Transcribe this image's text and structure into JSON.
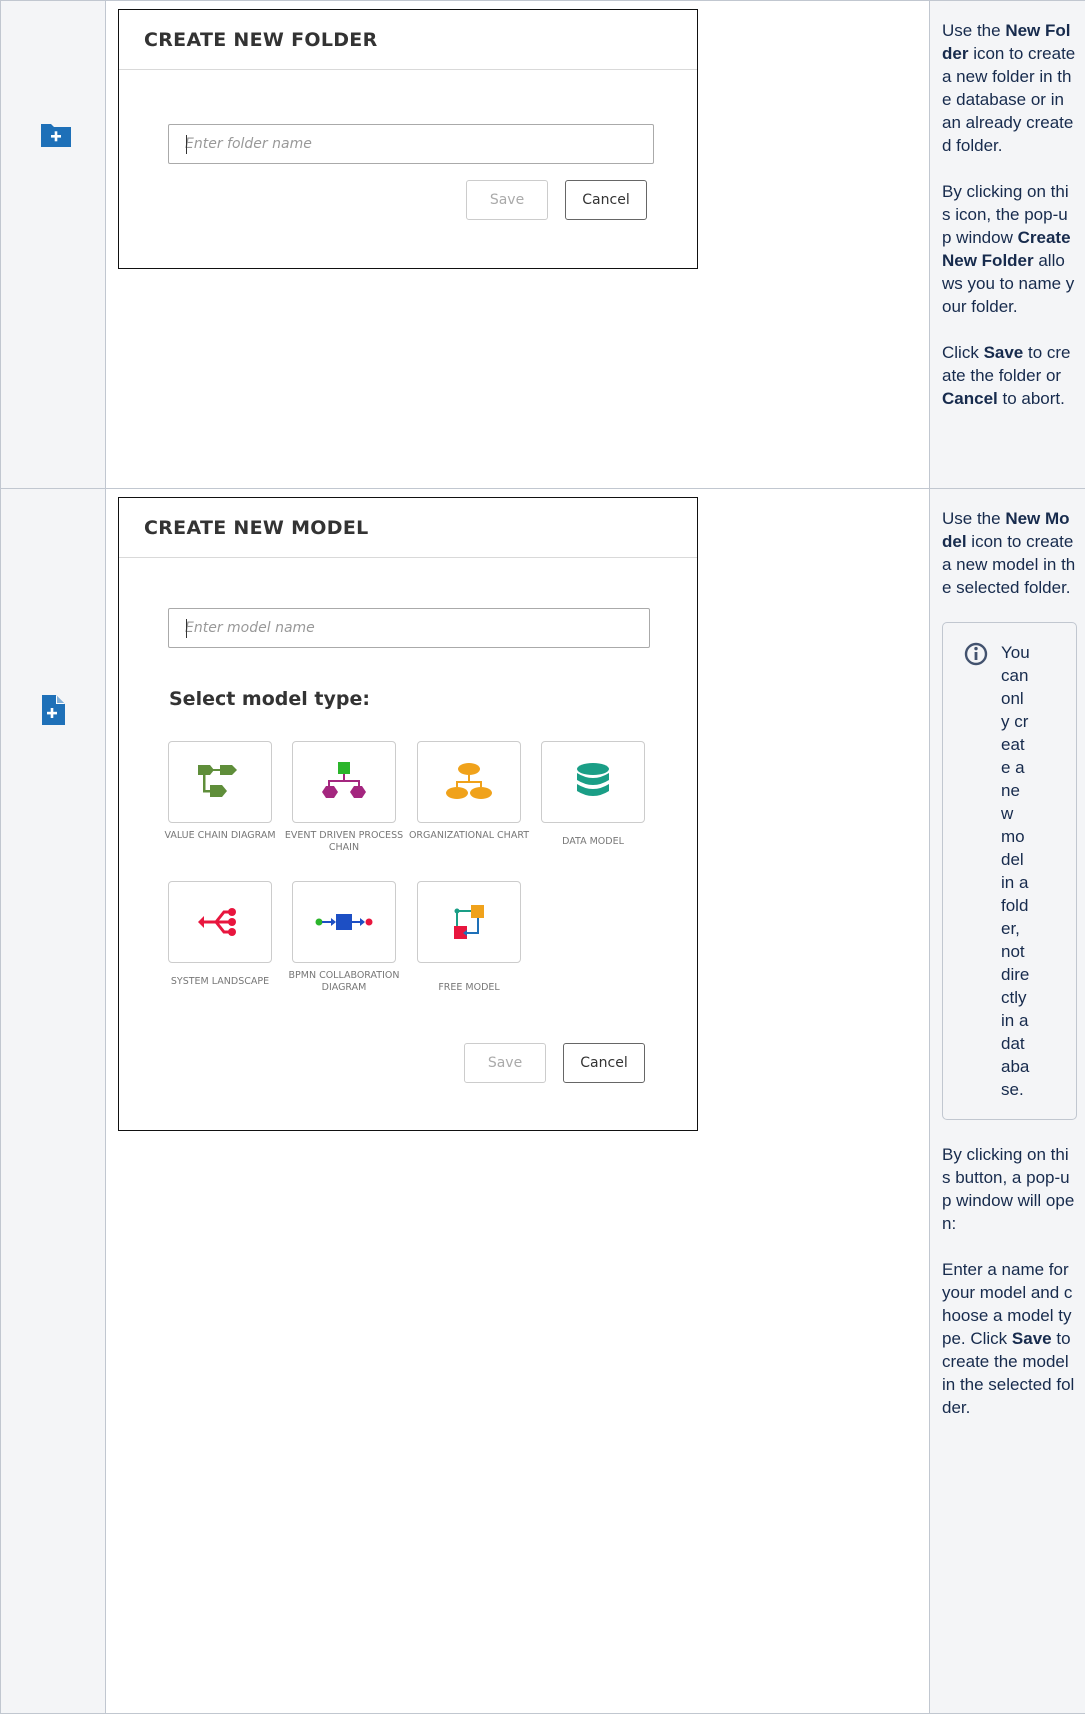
{
  "folder_row": {
    "icon": "new-folder-icon",
    "dialog": {
      "title": "CREATE NEW FOLDER",
      "input_placeholder": "Enter folder name",
      "save_label": "Save",
      "cancel_label": "Cancel"
    },
    "description": {
      "p1_a": "Use the ",
      "p1_b": "New Folder",
      "p1_c": " icon to create a new folder in the database or in an already created folder.",
      "p2_a": "By clicking on this icon, the pop-up window ",
      "p2_b": "Create New Folder",
      "p2_c": " allows you to name your folder.",
      "p3_a": "Click ",
      "p3_b": "Save",
      "p3_c": " to create the folder or ",
      "p3_d": "Cancel",
      "p3_e": " to abort."
    }
  },
  "model_row": {
    "icon": "new-model-icon",
    "dialog": {
      "title": "CREATE NEW MODEL",
      "input_placeholder": "Enter model name",
      "select_type_label": "Select model type:",
      "model_types": [
        {
          "label": "VALUE CHAIN DIAGRAM",
          "icon": "value-chain-icon"
        },
        {
          "label": "EVENT DRIVEN PROCESS CHAIN",
          "icon": "epc-icon"
        },
        {
          "label": "ORGANIZATIONAL CHART",
          "icon": "org-chart-icon"
        },
        {
          "label": "DATA MODEL",
          "icon": "database-icon"
        },
        {
          "label": "SYSTEM LANDSCAPE",
          "icon": "system-landscape-icon"
        },
        {
          "label": "BPMN COLLABORATION DIAGRAM",
          "icon": "bpmn-icon"
        },
        {
          "label": "FREE MODEL",
          "icon": "free-model-icon"
        }
      ],
      "save_label": "Save",
      "cancel_label": "Cancel"
    },
    "description": {
      "p1_a": "Use the ",
      "p1_b": "New Model",
      "p1_c": " icon to create a new model in the selected folder.",
      "info": "You can only create a new model in a folder, not directly in a database.",
      "p2": "By clicking on this button, a pop-up window will open:",
      "p3_a": "Enter a name for your model and choose a model type. Click ",
      "p3_b": "Save",
      "p3_c": " to create the model in the selected folder."
    }
  },
  "colors": {
    "icon_blue": "#1e70b8",
    "value_chain_green": "#5f8e3a",
    "epc_magenta": "#a4267f",
    "epc_green": "#2bb52b",
    "org_orange": "#f0a21b",
    "data_teal": "#1a9e86",
    "landscape_red": "#e8163e",
    "bpmn_blue": "#1d4fc4"
  }
}
